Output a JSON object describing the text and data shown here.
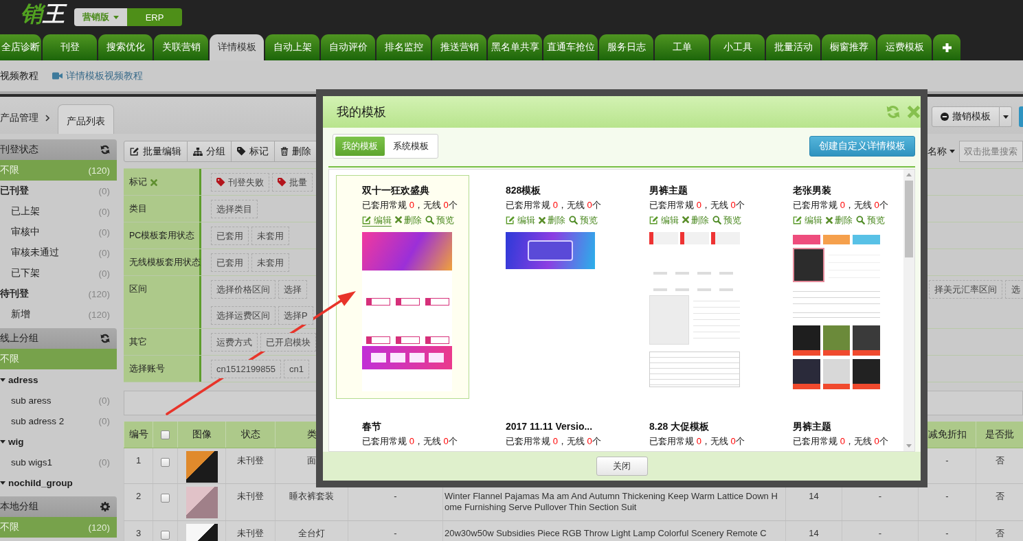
{
  "header": {
    "logo": "销王",
    "editions": [
      {
        "label": "营销版",
        "selected": true
      },
      {
        "label": "ERP",
        "selected": false
      }
    ]
  },
  "nav_tabs": [
    {
      "label": "全店诊断",
      "selected": false
    },
    {
      "label": "刊登",
      "selected": false
    },
    {
      "label": "搜索优化",
      "selected": false
    },
    {
      "label": "关联营销",
      "selected": false
    },
    {
      "label": "详情模板",
      "selected": true
    },
    {
      "label": "自动上架",
      "selected": false
    },
    {
      "label": "自动评价",
      "selected": false
    },
    {
      "label": "排名监控",
      "selected": false
    },
    {
      "label": "推送营销",
      "selected": false
    },
    {
      "label": "黑名单共享",
      "selected": false
    },
    {
      "label": "直通车抢位",
      "selected": false
    },
    {
      "label": "服务日志",
      "selected": false
    },
    {
      "label": "工单",
      "selected": false
    },
    {
      "label": "小工具",
      "selected": false
    },
    {
      "label": "批量活动",
      "selected": false
    },
    {
      "label": "橱窗推荐",
      "selected": false
    },
    {
      "label": "运费模板",
      "selected": false
    }
  ],
  "tutorial_links": [
    {
      "label": "视频教程",
      "kind": "plain"
    },
    {
      "label": "详情模板视频教程",
      "kind": "video"
    }
  ],
  "breadcrumb": {
    "parent": "产品管理",
    "tabs": [
      {
        "label": "产品列表",
        "selected": true
      }
    ]
  },
  "page_actions": {
    "revoke_button": "撤销模板"
  },
  "sidebar": [
    {
      "title": "刊登状态",
      "kind": "remote",
      "items": [
        {
          "label": "不限",
          "count": "(120)",
          "selected": true
        },
        {
          "label": "已刊登",
          "count": "(0)",
          "selected": false,
          "children": [
            {
              "label": "已上架",
              "count": "(0)",
              "selected": false
            },
            {
              "label": "审核中",
              "count": "(0)",
              "selected": false
            },
            {
              "label": "审核未通过",
              "count": "(0)",
              "selected": false
            },
            {
              "label": "已下架",
              "count": "(0)",
              "selected": false
            }
          ]
        },
        {
          "label": "待刊登",
          "count": "(120)",
          "selected": false,
          "children": [
            {
              "label": "新增",
              "count": "(120)",
              "selected": false
            }
          ]
        }
      ]
    },
    {
      "title": "线上分组",
      "kind": "remote",
      "items": [
        {
          "label": "不限",
          "selected": true
        },
        {
          "label": "adress",
          "selected": false,
          "expanded": true,
          "children": [
            {
              "label": "sub aress",
              "count": "(0)",
              "selected": false
            },
            {
              "label": "sub adress 2",
              "count": "(0)",
              "selected": false
            }
          ]
        },
        {
          "label": "wig",
          "selected": false,
          "expanded": true,
          "children": [
            {
              "label": "sub wigs1",
              "count": "(0)",
              "selected": false
            }
          ]
        },
        {
          "label": "nochild_group",
          "selected": false,
          "expanded": true
        }
      ]
    },
    {
      "title": "本地分组",
      "kind": "local",
      "items": [
        {
          "label": "不限",
          "count": "(120)",
          "selected": true
        }
      ]
    }
  ],
  "toolbar": {
    "buttons": [
      {
        "label": "批量编辑",
        "kind": "edit"
      },
      {
        "label": "分组",
        "kind": "group"
      },
      {
        "label": "标记",
        "kind": "tag"
      },
      {
        "label": "删除",
        "kind": "delete"
      }
    ],
    "search_by": "名称",
    "search": {
      "placeholder": "双击批量搜索"
    }
  },
  "filters": [
    {
      "label": "标记",
      "clearable": true,
      "lines": [
        {
          "options": [
            {
              "label": "刊登失败",
              "kind": "tag"
            },
            {
              "label": "批量",
              "kind": "tag"
            }
          ]
        }
      ]
    },
    {
      "label": "类目",
      "clearable": false,
      "lines": [
        {
          "options": [
            {
              "label": "选择类目",
              "kind": "plain"
            }
          ]
        }
      ]
    },
    {
      "label": "PC模板套用状态",
      "clearable": false,
      "lines": [
        {
          "options": [
            {
              "label": "已套用",
              "kind": "plain"
            },
            {
              "label": "未套用",
              "kind": "plain"
            }
          ]
        }
      ]
    },
    {
      "label": "无线模板套用状态",
      "clearable": false,
      "lines": [
        {
          "options": [
            {
              "label": "已套用",
              "kind": "plain"
            },
            {
              "label": "未套用",
              "kind": "plain"
            }
          ]
        }
      ]
    },
    {
      "label": "区间",
      "clearable": false,
      "lines": [
        {
          "options": [
            {
              "label": "选择价格区间",
              "kind": "plain"
            },
            {
              "label": "选择",
              "kind": "plain"
            }
          ],
          "more_options": [
            {
              "label": "择美元汇率区间"
            },
            {
              "label": "选"
            }
          ]
        },
        {
          "options": [
            {
              "label": "选择运费区间",
              "kind": "plain"
            },
            {
              "label": "选择P",
              "kind": "plain"
            }
          ]
        }
      ]
    },
    {
      "label": "其它",
      "clearable": false,
      "lines": [
        {
          "options": [
            {
              "label": "运费方式",
              "kind": "plain"
            },
            {
              "label": "已开启模块",
              "kind": "plain"
            }
          ]
        }
      ]
    },
    {
      "label": "选择账号",
      "clearable": false,
      "lines": [
        {
          "options": [
            {
              "label": "cn1512199855",
              "kind": "plain"
            },
            {
              "label": "cn1",
              "kind": "plain"
            }
          ]
        }
      ]
    }
  ],
  "table": {
    "columns": [
      {
        "kind": "text",
        "label": "编号"
      },
      {
        "kind": "checkbox",
        "checked": false
      },
      {
        "kind": "text",
        "label": "图像"
      },
      {
        "kind": "text",
        "label": "状态"
      },
      {
        "kind": "text",
        "label": "类"
      },
      {
        "kind": "text",
        "label": "减免折扣"
      },
      {
        "kind": "text",
        "label": "是否批"
      }
    ],
    "rows": [
      {
        "number": "1",
        "checked": false,
        "status": "未刊登",
        "category": "面",
        "discount": "-",
        "column_11": "否"
      },
      {
        "number": "2",
        "checked": false,
        "status": "未刊登",
        "category": "睡衣裤套装",
        "column_6": "-",
        "column_7": "Winter Flannel Pajamas Ma am And Autumn Thickening Keep Warm Lattice Down Home Furnishing Serve Pullover Thin Section Suit",
        "column_8": "14",
        "column_9": "-",
        "discount": "-",
        "column_11": "否"
      },
      {
        "number": "3",
        "checked": false,
        "status": "未刊登",
        "category": "全台灯",
        "column_6": "-",
        "column_7": "20w30w50w Subsidies Piece RGB Throw Light Lamp Colorful Scenery Remote C",
        "column_8": "14",
        "column_9": "-",
        "discount": "-",
        "column_11": "否"
      }
    ]
  },
  "dialog": {
    "title": "我的模板",
    "tabs": [
      {
        "label": "我的模板",
        "selected": true
      },
      {
        "label": "系统模板",
        "selected": false
      }
    ],
    "create_button": "创建自定义详情模板",
    "templates": [
      {
        "title": "双十一狂欢盛典",
        "selected": true,
        "usage": [
          {
            "text": "已套用常规 ",
            "highlight": false
          },
          {
            "text": "0",
            "highlight": true
          },
          {
            "text": "，无线 ",
            "highlight": false
          },
          {
            "text": "0",
            "highlight": true
          },
          {
            "text": "个",
            "highlight": false
          }
        ],
        "actions": [
          {
            "label": "编辑",
            "kind": "edit",
            "hovered": true
          },
          {
            "label": "删除",
            "kind": "delete",
            "hovered": false
          },
          {
            "label": "预览",
            "kind": "preview",
            "hovered": false
          }
        ],
        "preview": {
          "kind": "promo"
        }
      },
      {
        "title": "828模板",
        "selected": false,
        "usage": [
          {
            "text": "已套用常规 ",
            "highlight": false
          },
          {
            "text": "0",
            "highlight": true
          },
          {
            "text": "，无线 ",
            "highlight": false
          },
          {
            "text": "0",
            "highlight": true
          },
          {
            "text": "个",
            "highlight": false
          }
        ],
        "actions": [
          {
            "label": "编辑",
            "kind": "edit",
            "hovered": false
          },
          {
            "label": "删除",
            "kind": "delete",
            "hovered": false
          },
          {
            "label": "预览",
            "kind": "preview",
            "hovered": false
          }
        ],
        "preview": {
          "kind": "banner"
        }
      },
      {
        "title": "男裤主题",
        "selected": false,
        "usage": [
          {
            "text": "已套用常规 ",
            "highlight": false
          },
          {
            "text": "0",
            "highlight": true
          },
          {
            "text": "，无线 ",
            "highlight": false
          },
          {
            "text": "0",
            "highlight": true
          },
          {
            "text": "个",
            "highlight": false
          }
        ],
        "actions": [
          {
            "label": "编辑",
            "kind": "edit",
            "hovered": false
          },
          {
            "label": "删除",
            "kind": "delete",
            "hovered": false
          },
          {
            "label": "预览",
            "kind": "preview",
            "hovered": false
          }
        ],
        "preview": {
          "kind": "sizechart"
        }
      },
      {
        "title": "老张男装",
        "selected": false,
        "usage": [
          {
            "text": "已套用常规 ",
            "highlight": false
          },
          {
            "text": "0",
            "highlight": true
          },
          {
            "text": "，无线 ",
            "highlight": false
          },
          {
            "text": "0",
            "highlight": true
          },
          {
            "text": "个",
            "highlight": false
          }
        ],
        "actions": [
          {
            "label": "编辑",
            "kind": "edit",
            "hovered": false
          },
          {
            "label": "删除",
            "kind": "delete",
            "hovered": false
          },
          {
            "label": "预览",
            "kind": "preview",
            "hovered": false
          }
        ],
        "preview": {
          "kind": "catalog"
        }
      },
      {
        "title": "春节",
        "selected": false,
        "usage": [
          {
            "text": "已套用常规 ",
            "highlight": false
          },
          {
            "text": "0",
            "highlight": true
          },
          {
            "text": "，无线 ",
            "highlight": false
          },
          {
            "text": "0",
            "highlight": true
          },
          {
            "text": "个",
            "highlight": false
          }
        ]
      },
      {
        "title": "2017 11.11 Versio...",
        "selected": false,
        "usage": [
          {
            "text": "已套用常规 ",
            "highlight": false
          },
          {
            "text": "0",
            "highlight": true
          },
          {
            "text": "，无线 ",
            "highlight": false
          },
          {
            "text": "0",
            "highlight": true
          },
          {
            "text": "个",
            "highlight": false
          }
        ]
      },
      {
        "title": "8.28 大促模板",
        "selected": false,
        "usage": [
          {
            "text": "已套用常规 ",
            "highlight": false
          },
          {
            "text": "0",
            "highlight": true
          },
          {
            "text": "，无线 ",
            "highlight": false
          },
          {
            "text": "0",
            "highlight": true
          },
          {
            "text": "个",
            "highlight": false
          }
        ]
      },
      {
        "title": "男裤主题",
        "selected": false,
        "usage": [
          {
            "text": "已套用常规 ",
            "highlight": false
          },
          {
            "text": "0",
            "highlight": true
          },
          {
            "text": "，无线 ",
            "highlight": false
          },
          {
            "text": "0",
            "highlight": true
          },
          {
            "text": "个",
            "highlight": false
          }
        ]
      }
    ],
    "close_button": "关闭"
  }
}
